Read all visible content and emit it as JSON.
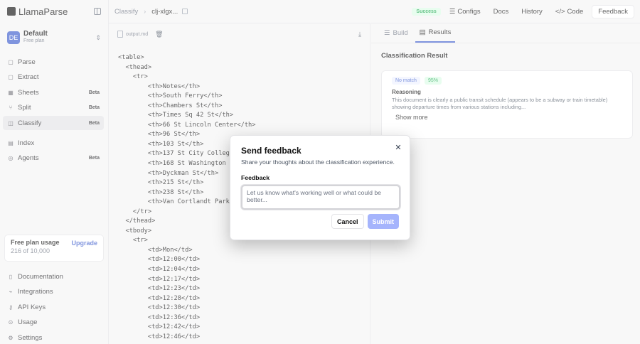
{
  "app": {
    "logo_text": "LlamaParse"
  },
  "workspace": {
    "initials": "DE",
    "name": "Default",
    "plan": "Free plan"
  },
  "sidebar": {
    "items": [
      {
        "label": "Parse",
        "icon": "parse-icon",
        "badge": ""
      },
      {
        "label": "Extract",
        "icon": "extract-icon",
        "badge": ""
      },
      {
        "label": "Sheets",
        "icon": "sheets-icon",
        "badge": "Beta"
      },
      {
        "label": "Split",
        "icon": "split-icon",
        "badge": "Beta"
      },
      {
        "label": "Classify",
        "icon": "classify-icon",
        "badge": "Beta"
      },
      {
        "label": "Index",
        "icon": "index-icon",
        "badge": ""
      },
      {
        "label": "Agents",
        "icon": "agents-icon",
        "badge": "Beta"
      }
    ],
    "footer_items": [
      {
        "label": "Documentation",
        "icon": "book-icon"
      },
      {
        "label": "Integrations",
        "icon": "integrations-icon"
      },
      {
        "label": "API Keys",
        "icon": "key-icon"
      },
      {
        "label": "Usage",
        "icon": "usage-icon"
      },
      {
        "label": "Settings",
        "icon": "gear-icon"
      }
    ],
    "usage": {
      "title": "Free plan usage",
      "count": "216 of 10,000",
      "upgrade": "Upgrade"
    }
  },
  "topbar": {
    "breadcrumb": [
      "Classify",
      "clj-xlgx..."
    ],
    "status": "Success",
    "buttons": [
      "Configs",
      "Docs",
      "History",
      "Code"
    ],
    "feedback": "Feedback"
  },
  "code_panel": {
    "filename": "output.md",
    "lines": [
      "<table>",
      "  <thead>",
      "    <tr>",
      "        <th>Notes</th>",
      "        <th>South Ferry</th>",
      "        <th>Chambers St</th>",
      "        <th>Times Sq 42 St</th>",
      "        <th>66 St Lincoln Center</th>",
      "        <th>96 St</th>",
      "        <th>103 St</th>",
      "        <th>137 St City College</th>",
      "        <th>168 St Washington Heights</th>",
      "        <th>Dyckman St</th>",
      "        <th>215 St</th>",
      "        <th>238 St</th>",
      "        <th>Van Cortlandt Park 242 St</th>",
      "    </tr>",
      "  </thead>",
      "  <tbody>",
      "    <tr>",
      "        <td>Mon</td>",
      "        <td>12:00</td>",
      "        <td>12:04</td>",
      "        <td>12:17</td>",
      "        <td>12:23</td>",
      "        <td>12:28</td>",
      "        <td>12:30</td>",
      "        <td>12:36</td>",
      "        <td>12:42</td>",
      "        <td>12:46</td>"
    ]
  },
  "right_panel": {
    "tabs": [
      {
        "label": "Build",
        "active": false
      },
      {
        "label": "Results",
        "active": true
      }
    ],
    "section_title": "Classification Result",
    "result": {
      "match": "No match",
      "confidence": "95%",
      "reasoning_label": "Reasoning",
      "reasoning_text": "This document is clearly a public transit schedule (appears to be a subway or train timetable) showing departure times from various stations including...",
      "show_more": "Show more"
    }
  },
  "modal": {
    "title": "Send feedback",
    "subtitle": "Share your thoughts about the classification experience.",
    "field_label": "Feedback",
    "placeholder": "Let us know what's working well or what could be better...",
    "value": "",
    "cancel": "Cancel",
    "submit": "Submit"
  }
}
